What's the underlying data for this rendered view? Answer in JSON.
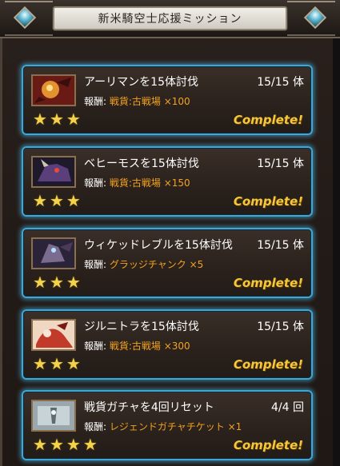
{
  "header": {
    "title": "新米騎空士応援ミッション"
  },
  "colors": {
    "accent_blue": "#3fa7d6",
    "reward_orange": "#f2a21f",
    "complete_gold": "#f6c73c",
    "star_gold": "#f4d34c"
  },
  "missions": [
    {
      "title": "アーリマンを15体討伐",
      "count": "15/15 体",
      "reward_label": "報酬:",
      "reward_value": "戦貨:古戦場 ×100",
      "stars": 3,
      "status": "Complete!"
    },
    {
      "title": "ベヒーモスを15体討伐",
      "count": "15/15 体",
      "reward_label": "報酬:",
      "reward_value": "戦貨:古戦場 ×150",
      "stars": 3,
      "status": "Complete!"
    },
    {
      "title": "ウィケッドレブルを15体討伐",
      "count": "15/15 体",
      "reward_label": "報酬:",
      "reward_value": "グラッジチャンク ×5",
      "stars": 3,
      "status": "Complete!"
    },
    {
      "title": "ジルニトラを15体討伐",
      "count": "15/15 体",
      "reward_label": "報酬:",
      "reward_value": "戦貨:古戦場 ×300",
      "stars": 3,
      "status": "Complete!"
    },
    {
      "title": "戦貨ガチャを4回リセット",
      "count": "4/4 回",
      "reward_label": "報酬:",
      "reward_value": "レジェンドガチャチケット ×1",
      "stars": 4,
      "status": "Complete!"
    }
  ]
}
